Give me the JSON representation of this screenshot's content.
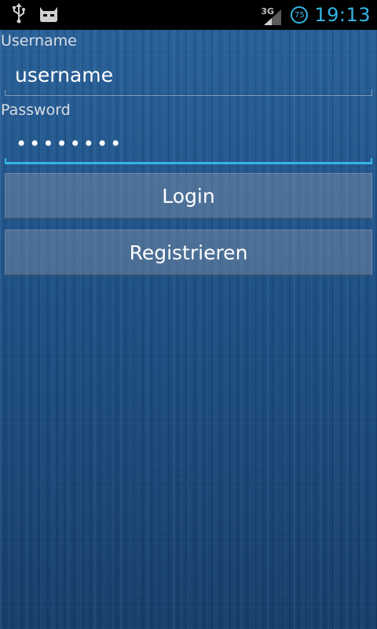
{
  "status_bar": {
    "left_icons": [
      "usb-icon",
      "cyanogenmod-icon"
    ],
    "network_type": "3G",
    "battery_level": "75",
    "time": "19:13",
    "accent_color": "#33b5e5"
  },
  "form": {
    "username": {
      "label": "Username",
      "value": "username"
    },
    "password": {
      "label": "Password",
      "masked_value": "••••••••"
    },
    "login_button": "Login",
    "register_button": "Registrieren"
  },
  "colors": {
    "background": "#1f4f80",
    "focus_underline": "#33b5e5"
  }
}
